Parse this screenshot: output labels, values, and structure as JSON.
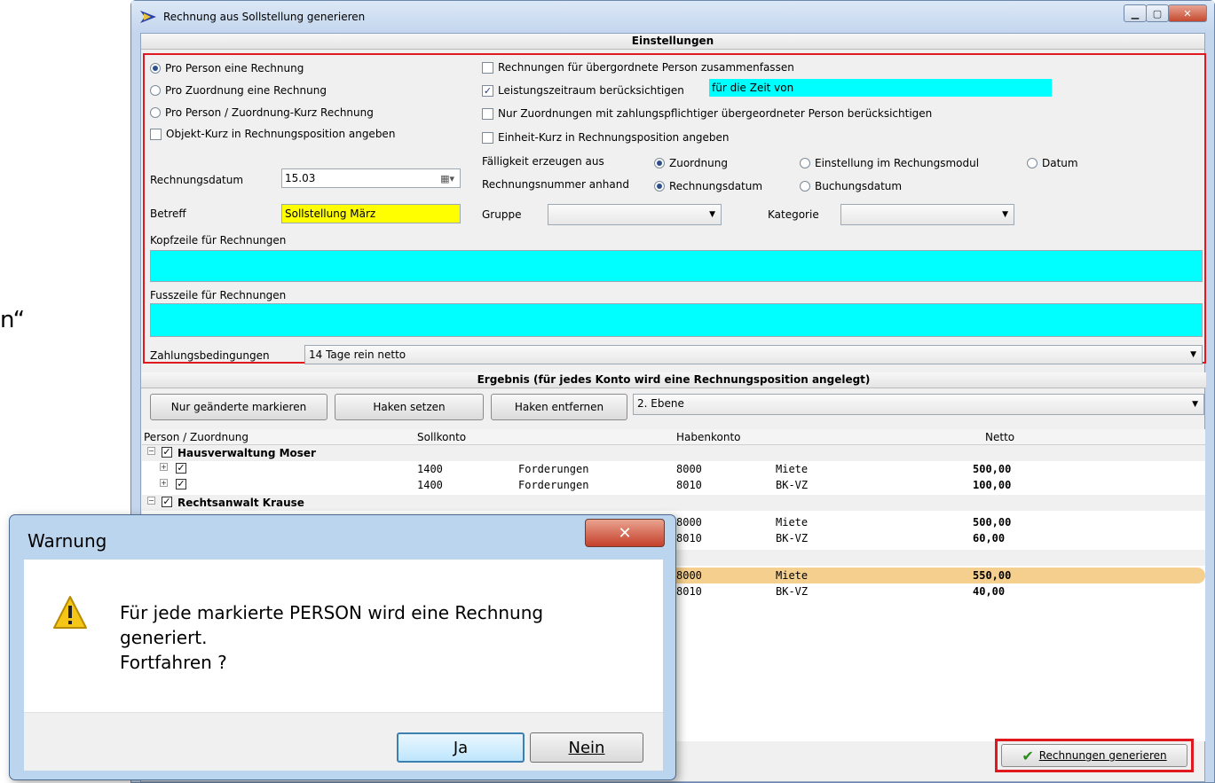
{
  "edge_text": "n“",
  "window": {
    "title": "Rechnung aus Sollstellung generieren"
  },
  "settings": {
    "section_title": "Einstellungen",
    "opt_pro_person": "Pro Person eine Rechnung",
    "opt_pro_zuordnung": "Pro Zuordnung eine Rechnung",
    "opt_pro_person_kurz": "Pro Person / Zuordnung-Kurz Rechnung",
    "chk_objekt_kurz": "Objekt-Kurz in Rechnungsposition angeben",
    "chk_zusammenfassen": "Rechnungen für übergordnete Person zusammenfassen",
    "chk_leistungszeitraum": "Leistungszeitraum berücksichtigen",
    "leistungszeitraum_value": "für die Zeit von",
    "chk_nur_zuordnungen": "Nur Zuordnungen mit zahlungspflichtiger übergeordneter Person berücksichtigen",
    "chk_einheit_kurz": "Einheit-Kurz in Rechnungsposition angeben",
    "faelligkeit_label": "Fälligkeit erzeugen aus",
    "faelligkeit_opt1": "Zuordnung",
    "faelligkeit_opt2": "Einstellung im Rechungsmodul",
    "faelligkeit_opt3": "Datum",
    "rechnungsnummer_label": "Rechnungsnummer anhand",
    "rechnungsnummer_opt1": "Rechnungsdatum",
    "rechnungsnummer_opt2": "Buchungsdatum",
    "rechnungsdatum_label": "Rechnungsdatum",
    "rechnungsdatum_value": "15.03",
    "betreff_label": "Betreff",
    "betreff_value": "Sollstellung März",
    "gruppe_label": "Gruppe",
    "kategorie_label": "Kategorie",
    "kopfzeile_label": "Kopfzeile für Rechnungen",
    "fusszeile_label": "Fusszeile für Rechnungen",
    "zahlungsbedingungen_label": "Zahlungsbedingungen",
    "zahlungsbedingungen_value": "14 Tage rein netto"
  },
  "result": {
    "section_title": "Ergebnis (für jedes Konto wird eine Rechnungsposition angelegt)",
    "btn_nur_geaenderte": "Nur geänderte markieren",
    "btn_haken_setzen": "Haken setzen",
    "btn_haken_entfernen": "Haken entfernen",
    "ebene_value": "2. Ebene",
    "columns": {
      "person": "Person / Zuordnung",
      "sollkonto": "Sollkonto",
      "habenkonto": "Habenkonto",
      "netto": "Netto"
    },
    "group1": "Hausverwaltung Moser",
    "group2": "Rechtsanwalt Krause",
    "rows": [
      {
        "soll": "1400",
        "soll_text": "Forderungen",
        "haben": "8000",
        "haben_text": "Miete",
        "netto": "500,00"
      },
      {
        "soll": "1400",
        "soll_text": "Forderungen",
        "haben": "8010",
        "haben_text": "BK-VZ",
        "netto": "100,00"
      },
      {
        "haben": "8000",
        "haben_text": "Miete",
        "netto": "500,00"
      },
      {
        "haben": "8010",
        "haben_text": "BK-VZ",
        "netto": "60,00"
      },
      {
        "haben": "8000",
        "haben_text": "Miete",
        "netto": "550,00"
      },
      {
        "haben": "8010",
        "haben_text": "BK-VZ",
        "netto": "40,00"
      }
    ],
    "generate_button": "Rechnungen generieren"
  },
  "dialog": {
    "title": "Warnung",
    "message": "Für jede markierte PERSON wird eine Rechnung\ngeneriert.\nFortfahren ?",
    "yes": "Ja",
    "no": "Nein"
  },
  "colors": {
    "highlight_field": "#00ffff",
    "betreff_field": "#ffff00",
    "frame_red": "#e0191e",
    "selected_row": "#f5cf8e"
  }
}
